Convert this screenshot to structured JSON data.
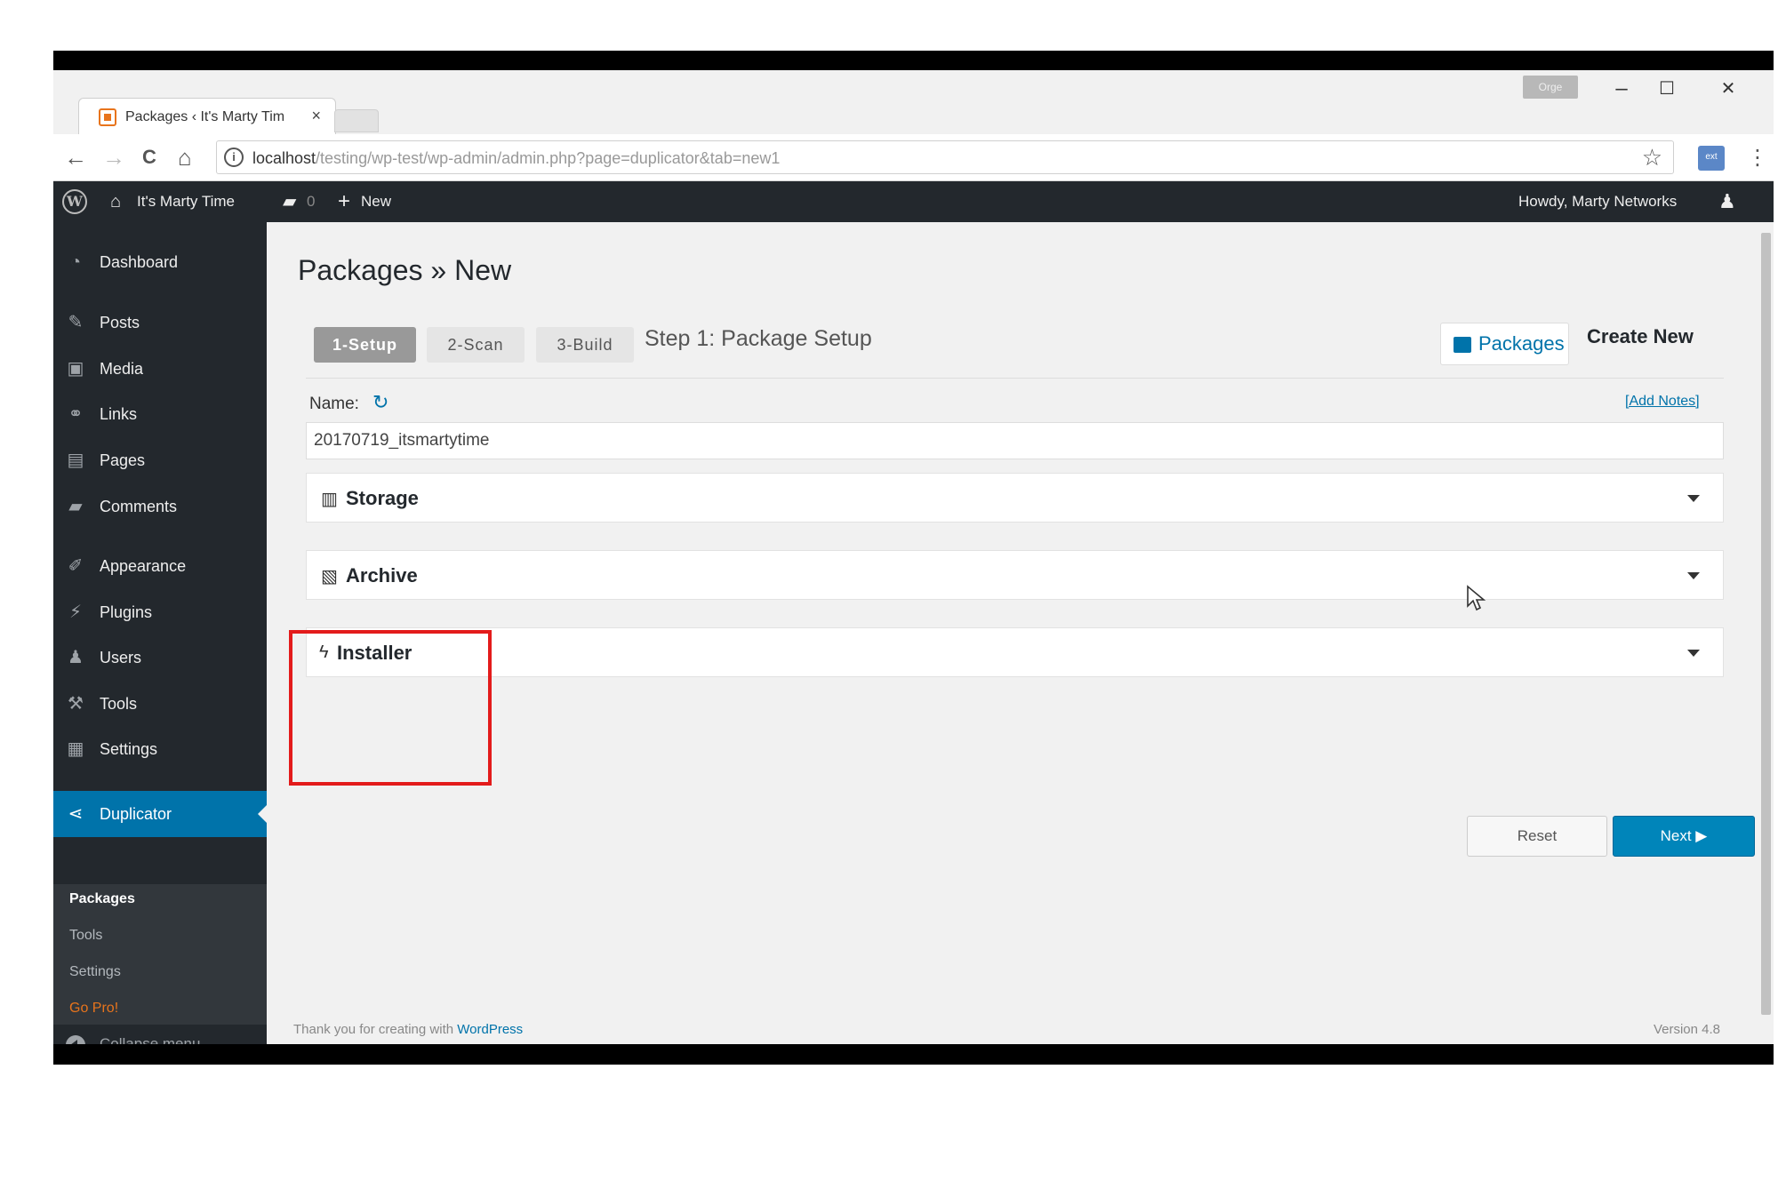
{
  "browser": {
    "tab_title": "Packages ‹ It's Marty Tim",
    "tab_close": "×",
    "badge": "Orge",
    "minimize": "–",
    "maximize": "☐",
    "close": "✕",
    "url_host": "localhost",
    "url_rest": "/testing/wp-test/wp-admin/admin.php?page=duplicator&tab=new1",
    "info_icon": "i",
    "back": "←",
    "forward": "→",
    "reload": "C",
    "home": "⌂",
    "star": "☆",
    "menu": "⋮",
    "ext_label": "ext"
  },
  "adminbar": {
    "site_name": "It's Marty Time",
    "comments_count": "0",
    "new_label": "New",
    "howdy": "Howdy, Marty Networks"
  },
  "sidebar": {
    "items": [
      {
        "label": "Dashboard",
        "icon": "dashboard-icon",
        "glyph": "◔"
      },
      {
        "label": "Posts",
        "icon": "pin-icon",
        "glyph": "✎"
      },
      {
        "label": "Media",
        "icon": "media-icon",
        "glyph": "▣"
      },
      {
        "label": "Links",
        "icon": "link-icon",
        "glyph": "⚭"
      },
      {
        "label": "Pages",
        "icon": "pages-icon",
        "glyph": "▤"
      },
      {
        "label": "Comments",
        "icon": "comment-icon",
        "glyph": "▰"
      },
      {
        "label": "Appearance",
        "icon": "brush-icon",
        "glyph": "✐"
      },
      {
        "label": "Plugins",
        "icon": "plug-icon",
        "glyph": "⚡"
      },
      {
        "label": "Users",
        "icon": "user-icon",
        "glyph": "♟"
      },
      {
        "label": "Tools",
        "icon": "wrench-icon",
        "glyph": "⚒"
      },
      {
        "label": "Settings",
        "icon": "settings-icon",
        "glyph": "▦"
      },
      {
        "label": "Duplicator",
        "icon": "share-icon",
        "glyph": "⋖"
      }
    ],
    "submenu": [
      "Packages",
      "Tools",
      "Settings",
      "Go Pro!"
    ],
    "collapse": "Collapse menu"
  },
  "main": {
    "title": "Packages » New",
    "steps": [
      "1-Setup",
      "2-Scan",
      "3-Build"
    ],
    "step_title": "Step 1: Package Setup",
    "packages_btn": "Packages",
    "create_new": "Create New",
    "name_label": "Name:",
    "add_notes": "[Add Notes]",
    "name_value": "20170719_itsmartytime",
    "panels": [
      {
        "label": "Storage",
        "icon": "database-icon",
        "glyph": "▥"
      },
      {
        "label": "Archive",
        "icon": "file-zip-icon",
        "glyph": "▧"
      },
      {
        "label": "Installer",
        "icon": "bolt-icon",
        "glyph": "ϟ"
      }
    ],
    "reset": "Reset",
    "next": "Next ▶",
    "footer_prefix": "Thank you for creating with ",
    "footer_link": "WordPress",
    "version": "Version 4.8"
  },
  "colors": {
    "admin_dark": "#23282d",
    "accent": "#0073aa",
    "highlight": "#e31b1b",
    "go_pro": "#e8741c"
  }
}
